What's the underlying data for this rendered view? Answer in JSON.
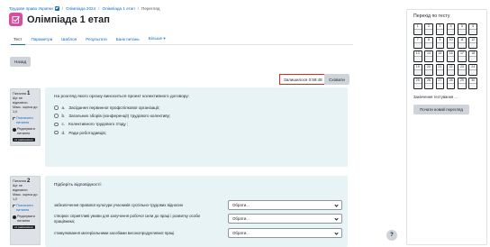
{
  "breadcrumb": [
    "Трудове право України",
    "Олімпіада 2024",
    "Олімпіада 1 етап",
    "Перегляд"
  ],
  "page_title": "Олімпіада 1 етап",
  "tabs": [
    "Тест",
    "Параметри",
    "Шаблон",
    "Результати",
    "Банк питань",
    "Більше"
  ],
  "back_label": "Назад",
  "timer_text": "Залишилося 0:59:48",
  "hide_label": "Сховати",
  "question1": {
    "label": "Питання",
    "number": "1",
    "status": "Ще не відповіли",
    "mark": "Макс. оцінка до 1,0",
    "flag": "Позначити питання",
    "edit": "Редагувати питання",
    "badge": "v1 (найновіша)",
    "text": "На розгляд якого органу виноситься проект колективного договору:",
    "options": [
      {
        "letter": "a.",
        "text": "Засідання первинної профспілкової організації;"
      },
      {
        "letter": "b.",
        "text": "Загальних зборів (конференції) трудового колективу;"
      },
      {
        "letter": "c.",
        "text": "Колективного трудового з'їзду ;"
      },
      {
        "letter": "d.",
        "text": "Ради роботодавців;"
      }
    ]
  },
  "question2": {
    "label": "Питання",
    "number": "2",
    "status": "Ще не відповіли",
    "mark": "Макс. оцінка до 1,0",
    "flag": "Позначити питання",
    "edit": "Редагувати питання",
    "badge": "v1 (найновіша)",
    "text": "Підберіть відповідності:",
    "rows": [
      {
        "line1": "забезпечення правової культури учасників суспільно-трудових відносин",
        "line2": "",
        "select": "Обрати..."
      },
      {
        "line1": "створює сприятливі умови для залучення робочої сили до праці і розвитку особи",
        "line2": "працівника;",
        "select": "Обрати..."
      },
      {
        "line1": "стимулювання матеріальними засобами високопродуктивної праці",
        "line2": "",
        "select": "Обрати..."
      }
    ]
  },
  "help_label": "?",
  "nav": {
    "title": "Перехід по тесту",
    "buttons": [
      "1",
      "2",
      "3",
      "4",
      "5",
      "6",
      "7",
      "8",
      "9",
      "10",
      "11",
      "12",
      "13",
      "14",
      "15",
      "16",
      "17",
      "18",
      "19",
      "20",
      "21",
      "22",
      "23",
      "24",
      "25",
      "26",
      "27",
      "28",
      "29",
      "30"
    ],
    "finish_link": "Закінчення тестування ...",
    "new_attempt": "Почати новий перегляд"
  }
}
